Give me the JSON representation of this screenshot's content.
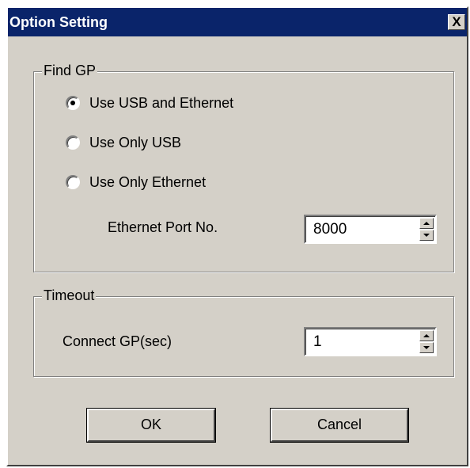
{
  "window": {
    "title": "Option Setting",
    "close_glyph": "X"
  },
  "find_gp": {
    "legend": "Find GP",
    "options": [
      {
        "label": "Use USB and Ethernet",
        "selected": true
      },
      {
        "label": "Use Only USB",
        "selected": false
      },
      {
        "label": "Use Only Ethernet",
        "selected": false
      }
    ],
    "port_label": "Ethernet Port No.",
    "port_value": "8000"
  },
  "timeout": {
    "legend": "Timeout",
    "connect_label": "Connect GP(sec)",
    "connect_value": "1"
  },
  "buttons": {
    "ok": "OK",
    "cancel": "Cancel"
  },
  "colors": {
    "titlebar": "#0a246a",
    "face": "#d4d0c8"
  }
}
